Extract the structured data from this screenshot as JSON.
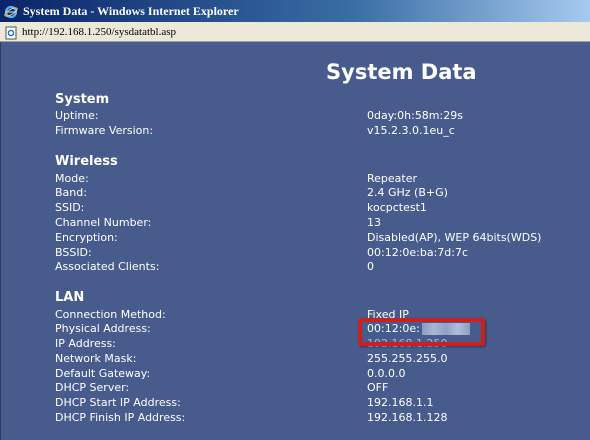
{
  "window": {
    "title": "System Data - Windows Internet Explorer",
    "address": "http://192.168.1.250/sysdatatbl.asp"
  },
  "page": {
    "title": "System Data"
  },
  "system": {
    "heading": "System",
    "rows": [
      {
        "label": "Uptime:",
        "value": "0day:0h:58m:29s"
      },
      {
        "label": "Firmware Version:",
        "value": "v15.2.3.0.1eu_c"
      }
    ]
  },
  "wireless": {
    "heading": "Wireless",
    "rows": [
      {
        "label": "Mode:",
        "value": "Repeater"
      },
      {
        "label": "Band:",
        "value": "2.4 GHz (B+G)"
      },
      {
        "label": "SSID:",
        "value": "kocpctest1"
      },
      {
        "label": "Channel Number:",
        "value": "13"
      },
      {
        "label": "Encryption:",
        "value": "Disabled(AP), WEP 64bits(WDS)"
      },
      {
        "label": "BSSID:",
        "value": "00:12:0e:ba:7d:7c"
      },
      {
        "label": "Associated Clients:",
        "value": "0"
      }
    ]
  },
  "lan": {
    "heading": "LAN",
    "rows": [
      {
        "label": "Connection Method:",
        "value": "Fixed IP"
      },
      {
        "label": "Physical Address:",
        "value": "00:12:0e:"
      },
      {
        "label": "IP Address:",
        "value": "192.168.1.250"
      },
      {
        "label": "Network Mask:",
        "value": "255.255.255.0"
      },
      {
        "label": "Default Gateway:",
        "value": "0.0.0.0"
      },
      {
        "label": "DHCP Server:",
        "value": "OFF"
      },
      {
        "label": "DHCP Start IP Address:",
        "value": "192.168.1.1"
      },
      {
        "label": "DHCP Finish IP Address:",
        "value": "192.168.1.128"
      }
    ]
  },
  "icons": {
    "browser": "internet-explorer-icon",
    "page": "page-icon"
  },
  "colors": {
    "content_bg": "#475c8c",
    "highlight": "#cc1f1f",
    "titlebar": "#0a246a"
  }
}
